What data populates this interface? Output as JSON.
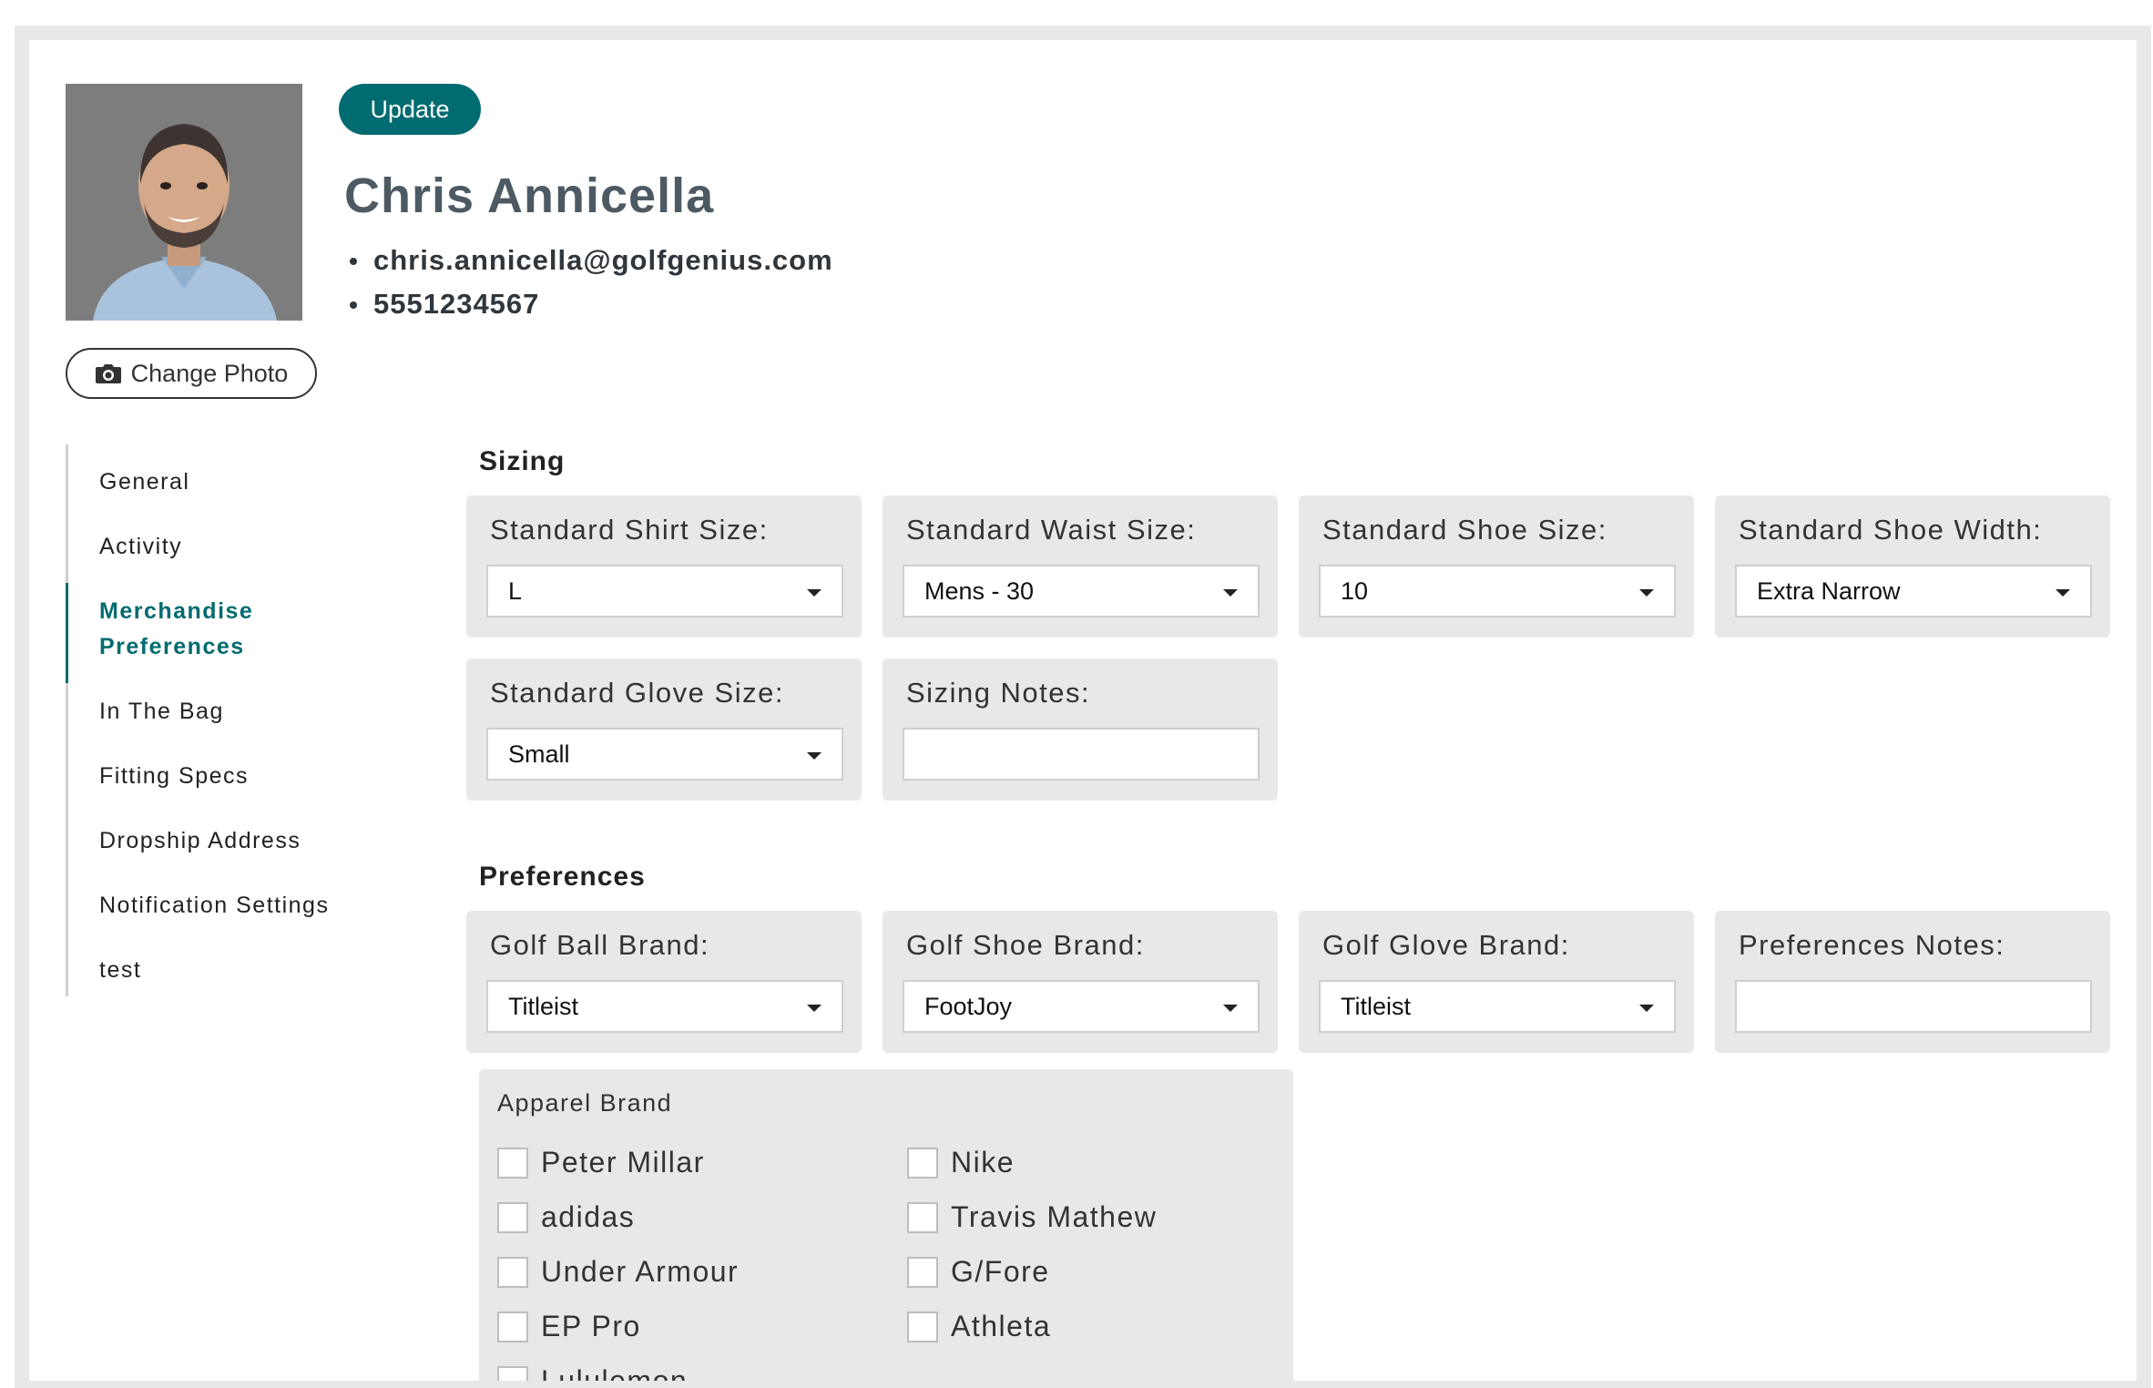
{
  "profile": {
    "update_label": "Update",
    "name": "Chris Annicella",
    "email": "chris.annicella@golfgenius.com",
    "phone": "5551234567",
    "change_photo_label": "Change Photo"
  },
  "nav": {
    "items": [
      {
        "label": "General"
      },
      {
        "label": "Activity"
      },
      {
        "label": "Merchandise Preferences"
      },
      {
        "label": "In The Bag"
      },
      {
        "label": "Fitting Specs"
      },
      {
        "label": "Dropship Address"
      },
      {
        "label": "Notification Settings"
      },
      {
        "label": "test"
      }
    ],
    "active": "Merchandise Preferences"
  },
  "sizing": {
    "title": "Sizing",
    "shirt": {
      "label": "Standard Shirt Size:",
      "value": "L"
    },
    "waist": {
      "label": "Standard Waist Size:",
      "value": "Mens - 30"
    },
    "shoe": {
      "label": "Standard Shoe Size:",
      "value": "10"
    },
    "shoe_width": {
      "label": "Standard Shoe Width:",
      "value": "Extra Narrow"
    },
    "glove": {
      "label": "Standard Glove Size:",
      "value": "Small"
    },
    "notes": {
      "label": "Sizing Notes:",
      "value": ""
    }
  },
  "preferences": {
    "title": "Preferences",
    "ball": {
      "label": "Golf Ball Brand:",
      "value": "Titleist"
    },
    "shoe": {
      "label": "Golf Shoe Brand:",
      "value": "FootJoy"
    },
    "glove": {
      "label": "Golf Glove Brand:",
      "value": "Titleist"
    },
    "notes": {
      "label": "Preferences Notes:",
      "value": ""
    }
  },
  "apparel": {
    "title": "Apparel Brand",
    "brands": [
      {
        "label": "Peter Millar",
        "checked": false
      },
      {
        "label": "Nike",
        "checked": false
      },
      {
        "label": "adidas",
        "checked": false
      },
      {
        "label": "Travis Mathew",
        "checked": false
      },
      {
        "label": "Under Armour",
        "checked": false
      },
      {
        "label": "G/Fore",
        "checked": false
      },
      {
        "label": "EP Pro",
        "checked": false
      },
      {
        "label": "Athleta",
        "checked": false
      },
      {
        "label": "Lululemon",
        "checked": false
      }
    ]
  },
  "colors": {
    "accent": "#006b70",
    "scrollbar": "#ff5a36",
    "card_bg": "#e8e8e8"
  },
  "icons": {
    "camera": "camera-icon",
    "dropdown": "chevron-down-icon"
  }
}
